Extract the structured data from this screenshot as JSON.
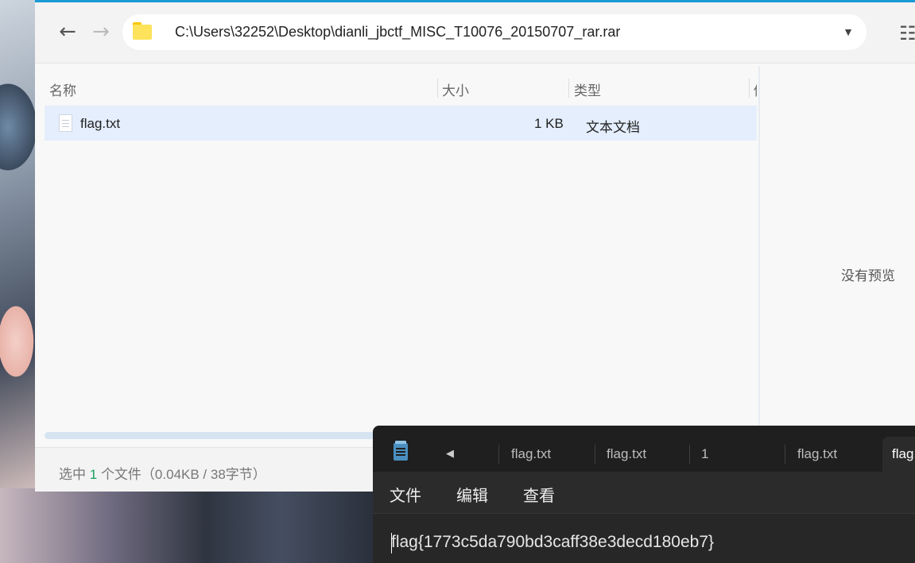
{
  "explorer": {
    "address_path": "C:\\Users\\32252\\Desktop\\dianli_jbctf_MISC_T10076_20150707_rar.rar",
    "columns": [
      "名称",
      "大小",
      "类型",
      "修"
    ],
    "files": [
      {
        "name": "flag.txt",
        "size": "1 KB",
        "type": "文本文档"
      }
    ],
    "preview_text": "没有预览",
    "status": {
      "prefix": "选中",
      "count": "1",
      "suffix": "个文件（0.04KB / 38字节）"
    }
  },
  "notepad": {
    "tabs": [
      "flag.txt",
      "flag.txt",
      "1",
      "flag.txt",
      "flag.txt"
    ],
    "menu": [
      "文件",
      "编辑",
      "查看"
    ],
    "content": "flag{1773c5da790bd3caff38e3decd180eb7}"
  },
  "icons": [
    "back-arrow-icon",
    "forward-arrow-icon",
    "folder-icon",
    "dropdown-chevron-icon",
    "view-toggle-icon",
    "text-file-icon",
    "notepad-app-icon",
    "tab-scroll-left-icon"
  ],
  "colors": {
    "accent": "#1a9ad6",
    "selection": "#e4eefc",
    "status_count": "#19a15f"
  }
}
